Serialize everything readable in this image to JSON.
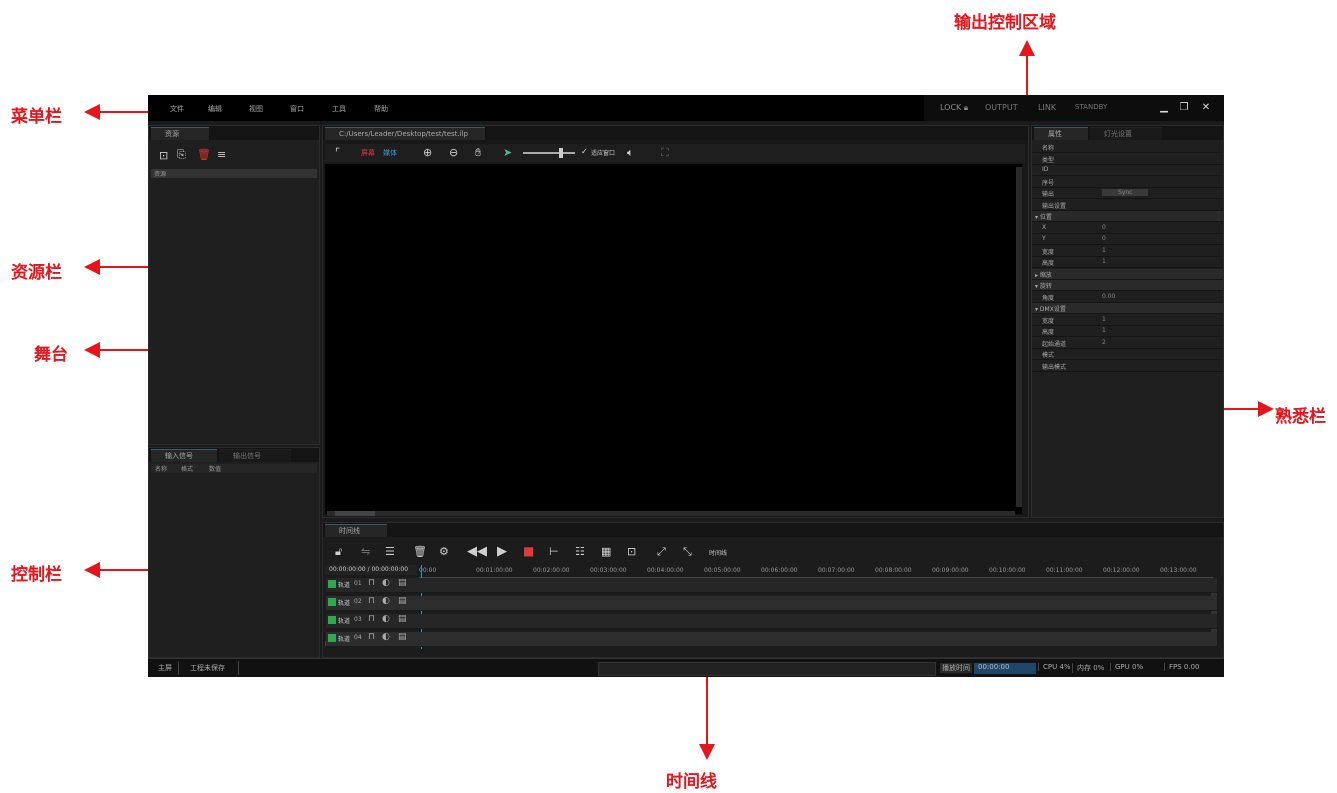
{
  "callouts": {
    "menu_bar": "菜单栏",
    "resource_bar": "资源栏",
    "stage": "舞台",
    "control_bar": "控制栏",
    "output_control": "输出控制区域",
    "properties_bar": "熟悉栏",
    "timeline": "时间线"
  },
  "menubar": {
    "items": [
      "文件",
      "编辑",
      "视图",
      "窗口",
      "工具",
      "帮助"
    ],
    "output": {
      "lock": "LOCK",
      "output": "OUTPUT",
      "link": "LINK",
      "standby": "STANDBY"
    }
  },
  "resource_panel": {
    "tab": "资源",
    "header": "资源"
  },
  "stage_panel": {
    "tab": "C:/Users/Leader/Desktop/test/test.ilp",
    "toolbar": {
      "btn_red": "屏幕",
      "btn_blue": "媒体",
      "checkbox_label": "适应窗口"
    }
  },
  "control_panel": {
    "tabs": [
      "输入信号",
      "输出信号"
    ],
    "columns": [
      "名称",
      "格式",
      "数值"
    ]
  },
  "properties_panel": {
    "tabs": [
      "属性",
      "灯光设置"
    ],
    "rows": [
      {
        "label": "名称",
        "value": ""
      },
      {
        "label": "类型",
        "value": ""
      },
      {
        "label": "ID",
        "value": ""
      },
      {
        "label": "序号",
        "value": ""
      },
      {
        "label": "输出",
        "value": "Sync"
      },
      {
        "label": "输出设置",
        "value": ""
      },
      {
        "label": "▾ 位置",
        "value": ""
      },
      {
        "label": "X",
        "value": "0"
      },
      {
        "label": "Y",
        "value": "0"
      },
      {
        "label": "宽度",
        "value": "1"
      },
      {
        "label": "高度",
        "value": "1"
      },
      {
        "label": "▸ 缩放",
        "value": ""
      },
      {
        "label": "▾ 旋转",
        "value": ""
      },
      {
        "label": "角度",
        "value": "0.00"
      },
      {
        "label": "▾ DMX设置",
        "value": ""
      },
      {
        "label": "宽度",
        "value": "1"
      },
      {
        "label": "高度",
        "value": "1"
      },
      {
        "label": "起始通道",
        "value": "2"
      },
      {
        "label": "模式",
        "value": ""
      },
      {
        "label": "输出模式",
        "value": ""
      }
    ]
  },
  "timeline": {
    "tab": "时间线",
    "timecode": "00:00:00:00 / 00:00:00:00",
    "ruler": [
      "00:00",
      "00:01:00:00",
      "00:02:00:00",
      "00:03:00:00",
      "00:04:00:00",
      "00:05:00:00",
      "00:06:00:00",
      "00:07:00:00",
      "00:08:00:00",
      "00:09:00:00",
      "00:10:00:00",
      "00:11:00:00",
      "00:12:00:00",
      "00:13:00:00"
    ],
    "tracks": [
      {
        "name": "轨道",
        "num": "01"
      },
      {
        "name": "轨道",
        "num": "02"
      },
      {
        "name": "轨道",
        "num": "03"
      },
      {
        "name": "轨道",
        "num": "04"
      }
    ],
    "toolbar_text": "时间线"
  },
  "statusbar": {
    "left1": "主屏",
    "left2": "工程未保存",
    "right_label": "播放时间",
    "cells": [
      "00:00:00",
      "CPU 4%",
      "内存 0%",
      "GPU 0%",
      "FPS 0.00"
    ]
  }
}
